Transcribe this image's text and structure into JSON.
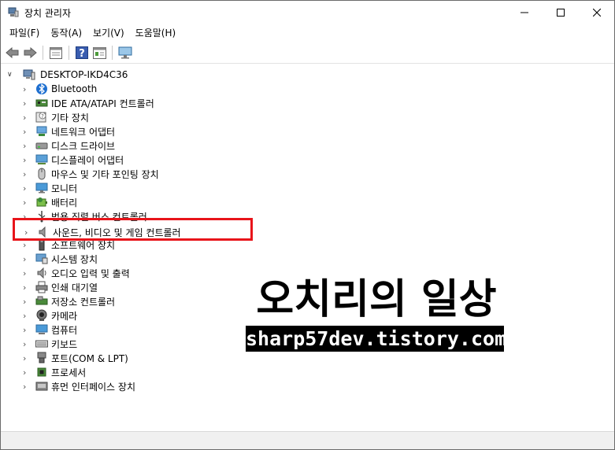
{
  "window": {
    "title": "장치 관리자"
  },
  "menu": [
    "파일(F)",
    "동작(A)",
    "보기(V)",
    "도움말(H)"
  ],
  "toolbar": [
    "back-icon",
    "forward-icon",
    "properties-icon",
    "help-icon",
    "update-driver-icon",
    "monitor-icon"
  ],
  "tree": {
    "root": "DESKTOP-IKD4C36",
    "items": [
      {
        "label": "Bluetooth",
        "icon": "bluetooth-icon"
      },
      {
        "label": "IDE ATA/ATAPI 컨트롤러",
        "icon": "ide-controller-icon"
      },
      {
        "label": "기타 장치",
        "icon": "other-devices-icon"
      },
      {
        "label": "네트워크 어댑터",
        "icon": "network-adapter-icon"
      },
      {
        "label": "디스크 드라이브",
        "icon": "disk-drive-icon"
      },
      {
        "label": "디스플레이 어댑터",
        "icon": "display-adapter-icon"
      },
      {
        "label": "마우스 및 기타 포인팅 장치",
        "icon": "mouse-icon"
      },
      {
        "label": "모니터",
        "icon": "monitor-icon"
      },
      {
        "label": "배터리",
        "icon": "battery-icon"
      },
      {
        "label": "범용 직렬 버스 컨트롤러",
        "icon": "usb-controller-icon"
      },
      {
        "label": "사운드, 비디오 및 게임 컨트롤러",
        "icon": "speaker-icon"
      },
      {
        "label": "소프트웨어 장치",
        "icon": "software-device-icon"
      },
      {
        "label": "시스템 장치",
        "icon": "system-device-icon"
      },
      {
        "label": "오디오 입력 및 출력",
        "icon": "audio-io-icon"
      },
      {
        "label": "인쇄 대기열",
        "icon": "printer-icon"
      },
      {
        "label": "저장소 컨트롤러",
        "icon": "storage-controller-icon"
      },
      {
        "label": "카메라",
        "icon": "camera-icon"
      },
      {
        "label": "컴퓨터",
        "icon": "computer-icon"
      },
      {
        "label": "키보드",
        "icon": "keyboard-icon"
      },
      {
        "label": "포트(COM & LPT)",
        "icon": "port-icon"
      },
      {
        "label": "프로세서",
        "icon": "processor-icon"
      },
      {
        "label": "휴먼 인터페이스 장치",
        "icon": "hid-icon"
      }
    ]
  },
  "watermark": {
    "title": "오치리의 일상",
    "url": "sharp57dev.tistory.com"
  },
  "colors": {
    "highlight": "#e8141a",
    "accent": "#1e88c7"
  }
}
